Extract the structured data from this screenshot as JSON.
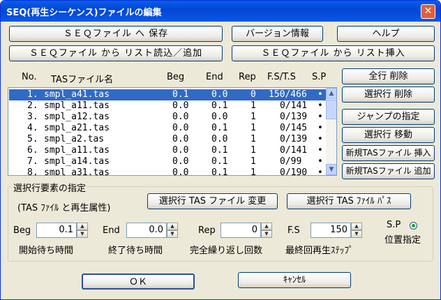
{
  "window": {
    "title": "SEQ(再生シーケンス)ファイルの編集",
    "close": "✕"
  },
  "buttons": {
    "save": "ＳＥＱファイル へ 保存",
    "version": "バージョン情報",
    "help": "ヘルプ",
    "read_add": "ＳＥＱファイル から リスト読込／追加",
    "insert": "ＳＥＱファイル から リスト挿入",
    "delete_all": "全行 削除",
    "delete_sel": "選択行 削除",
    "jump": "ジャンプの指定",
    "move": "選択行 移動",
    "new_insert": "新規TASファイル 挿入",
    "new_add": "新規TASファイル 追加",
    "change_tas": "選択行 TAS ファイル 変更",
    "tas_path": "選択行 TAS ﾌｧｲﾙ ﾊﾟｽ",
    "ok": "ＯＫ",
    "cancel": "ｷｬﾝｾﾙ"
  },
  "columns": [
    "No.",
    "TASファイル名",
    "Beg",
    "End",
    "Rep",
    "F.S/T.S",
    "S.P"
  ],
  "rows": [
    {
      "no": "1.",
      "file": "smpl_a41.tas",
      "beg": "0.1",
      "end": "0.0",
      "rep": "0",
      "fsts": "150/466",
      "sp": "•"
    },
    {
      "no": "2.",
      "file": "smpl_a11.tas",
      "beg": "0.0",
      "end": "0.1",
      "rep": "1",
      "fsts": "0/141",
      "sp": "•"
    },
    {
      "no": "3.",
      "file": "smpl_a12.tas",
      "beg": "0.0",
      "end": "0.0",
      "rep": "1",
      "fsts": "0/139",
      "sp": "•"
    },
    {
      "no": "4.",
      "file": "smpl_a21.tas",
      "beg": "0.0",
      "end": "0.1",
      "rep": "1",
      "fsts": "0/145",
      "sp": "•"
    },
    {
      "no": "5.",
      "file": "smpl_a2.tas",
      "beg": "0.0",
      "end": "0.0",
      "rep": "1",
      "fsts": "0/139",
      "sp": "•"
    },
    {
      "no": "6.",
      "file": "smpl_a11.tas",
      "beg": "0.0",
      "end": "0.1",
      "rep": "1",
      "fsts": "0/141",
      "sp": "•"
    },
    {
      "no": "7.",
      "file": "smpl_a14.tas",
      "beg": "0.0",
      "end": "0.1",
      "rep": "1",
      "fsts": "0/99",
      "sp": "•"
    },
    {
      "no": "8.",
      "file": "smpl_a31.tas",
      "beg": "0.0",
      "end": "0.1",
      "rep": "1",
      "fsts": "0/190",
      "sp": "•"
    }
  ],
  "group": {
    "title": "選択行要素の指定",
    "desc": "(TAS ﾌｧｲﾙ と再生属性)",
    "beg_label": "Beg",
    "beg_value": "0.1",
    "beg_desc": "開始待ち時間",
    "end_label": "End",
    "end_value": "0.0",
    "end_desc": "終了待ち時間",
    "rep_label": "Rep",
    "rep_value": "0",
    "rep_desc": "完全繰り返し回数",
    "fs_label": "F.S",
    "fs_value": "150",
    "fs_desc": "最終回再生ｽﾃｯﾌﾟ",
    "sp_label": "S.P",
    "sp_desc": "位置指定"
  },
  "colors": {
    "selection": "#316ac5",
    "title_bar": "#0a5fe8",
    "face": "#ece9d8"
  }
}
